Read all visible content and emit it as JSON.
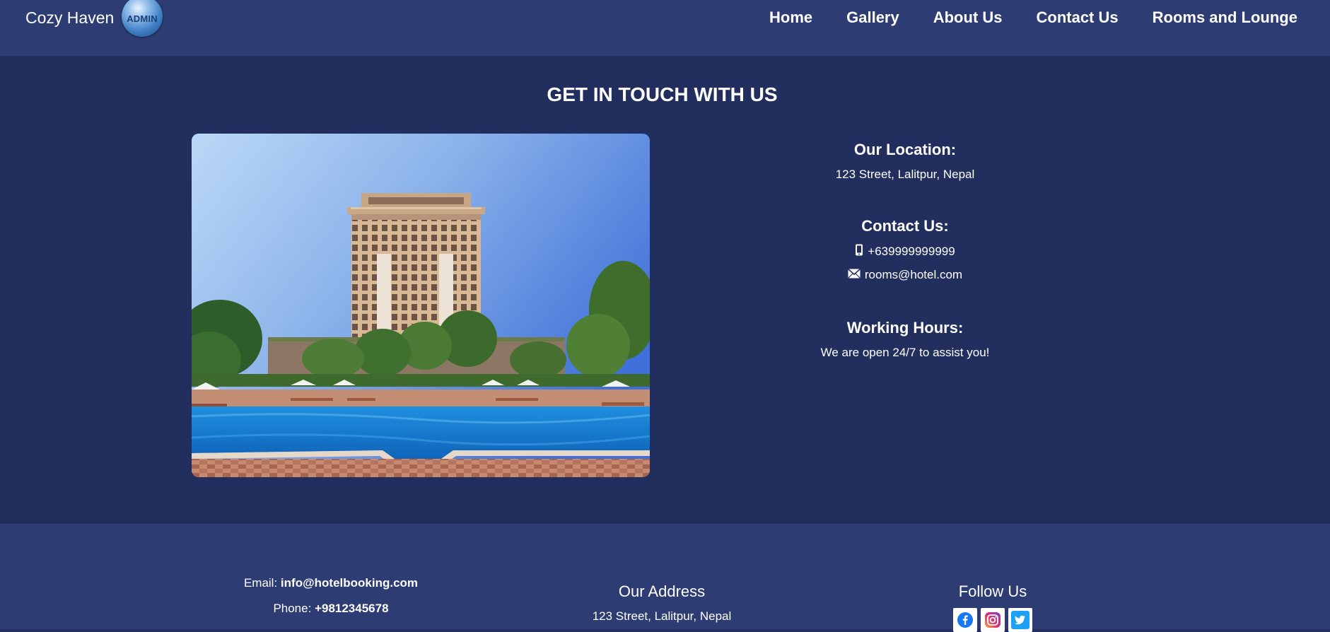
{
  "header": {
    "brand": "Cozy Haven",
    "badge_text": "ADMIN",
    "nav": [
      {
        "label": "Home"
      },
      {
        "label": "Gallery"
      },
      {
        "label": "About Us"
      },
      {
        "label": "Contact Us"
      },
      {
        "label": "Rooms and Lounge"
      }
    ]
  },
  "contact_section": {
    "title": "GET IN TOUCH WITH US",
    "location_heading": "Our Location:",
    "location_text": "123 Street, Lalitpur, Nepal",
    "contact_heading": "Contact Us:",
    "phone": "+639999999999",
    "email": "rooms@hotel.com",
    "hours_heading": "Working Hours:",
    "hours_text": "We are open 24/7 to assist you!"
  },
  "footer": {
    "email_label": "Email:",
    "email_value": "info@hotelbooking.com",
    "phone_label": "Phone:",
    "phone_value": "+9812345678",
    "address_heading": "Our Address",
    "address_text": "123 Street, Lalitpur, Nepal",
    "follow_heading": "Follow Us",
    "social": [
      {
        "icon": "facebook-icon"
      },
      {
        "icon": "instagram-icon"
      },
      {
        "icon": "twitter-icon"
      }
    ]
  },
  "colors": {
    "page_bg": "#222f5e",
    "nav_bg": "#2d3d74",
    "text": "#ffffff",
    "facebook": "#1877f2",
    "twitter": "#1da1f2"
  }
}
